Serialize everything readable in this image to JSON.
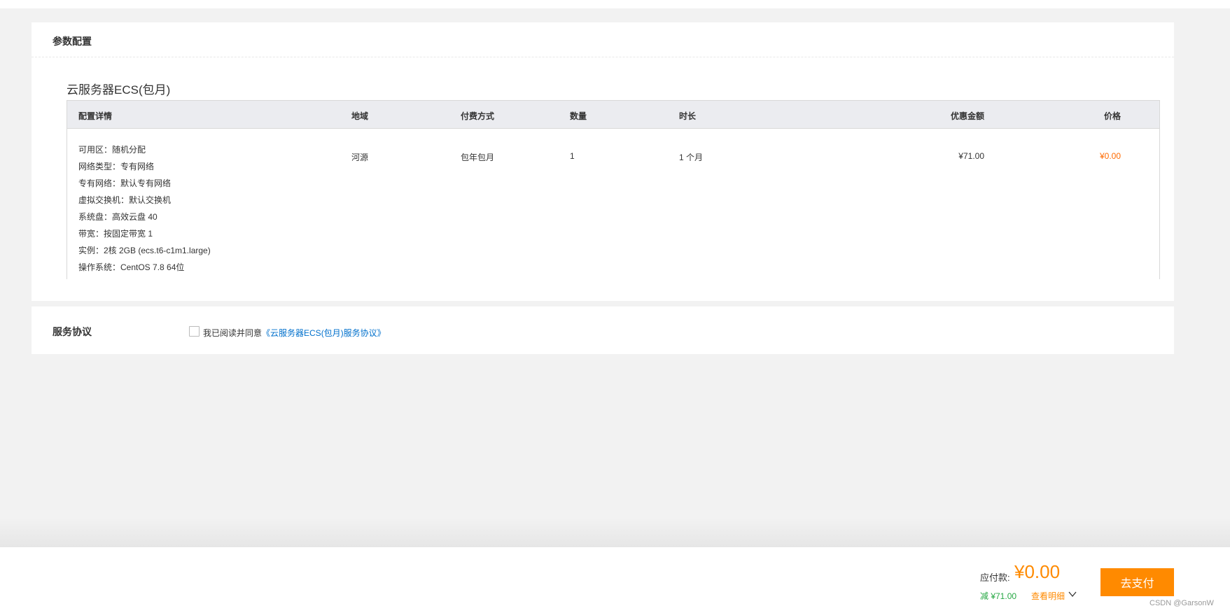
{
  "config_section": {
    "title": "参数配置",
    "product_title": "云服务器ECS(包月)",
    "table": {
      "headers": [
        "配置详情",
        "地域",
        "付费方式",
        "数量",
        "时长",
        "优惠金额",
        "价格"
      ],
      "row": {
        "details": [
          "可用区：随机分配",
          "网络类型：专有网络",
          "专有网络：默认专有网络",
          "虚拟交换机：默认交换机",
          "系统盘：高效云盘 40",
          "带宽：按固定带宽 1",
          "实例：2核 2GB (ecs.t6-c1m1.large)",
          "操作系统：CentOS 7.8 64位"
        ],
        "region": "河源",
        "billing": "包年包月",
        "quantity": "1",
        "duration": "1 个月",
        "discount": "¥71.00",
        "price": "¥0.00"
      }
    }
  },
  "agreement": {
    "title": "服务协议",
    "text": "我已阅读并同意",
    "link": "《云服务器ECS(包月)服务协议》",
    "checked": false
  },
  "footer": {
    "pay_label": "应付款:",
    "pay_amount": "¥0.00",
    "discount": "减 ¥71.00",
    "detail_link": "查看明细",
    "pay_button": "去支付",
    "watermark": "CSDN @GarsonW"
  },
  "colors": {
    "accent": "#ff8a00",
    "price": "#ff6a00",
    "link": "#0070cc",
    "discount": "#27a844",
    "table_header_bg": "#ebecf0"
  }
}
